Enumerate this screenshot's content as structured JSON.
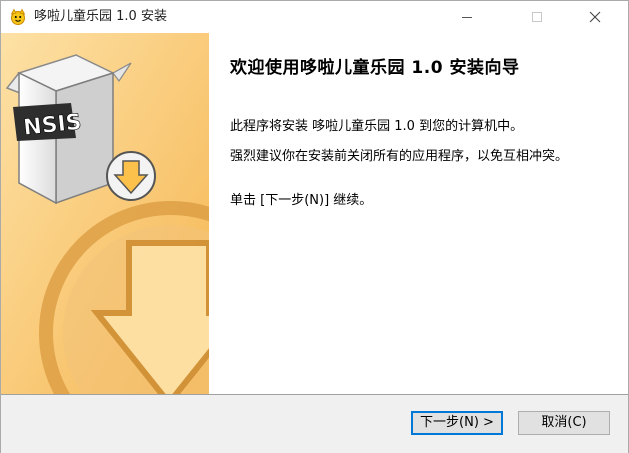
{
  "window": {
    "title": "哆啦儿童乐园 1.0 安装",
    "controls": [
      "minimize-icon",
      "maximize-icon",
      "close-icon"
    ]
  },
  "banner": {
    "logo_text": "NSIS",
    "accent_color": "#f7b13a"
  },
  "main": {
    "heading": "欢迎使用哆啦儿童乐园 1.0 安装向导",
    "paragraph1": "此程序将安装 哆啦儿童乐园 1.0 到您的计算机中。",
    "paragraph2": "强烈建议你在安装前关闭所有的应用程序，以免互相冲突。",
    "paragraph3": "单击 [下一步(N)] 继续。"
  },
  "footer": {
    "next_label": "下一步(N) >",
    "cancel_label": "取消(C)"
  }
}
